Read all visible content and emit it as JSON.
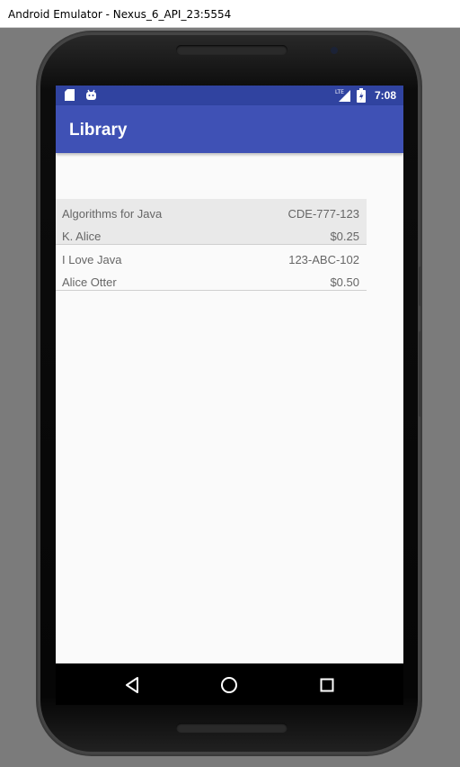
{
  "window": {
    "title": "Android Emulator - Nexus_6_API_23:5554"
  },
  "statusbar": {
    "time": "7:08",
    "network_label": "LTE"
  },
  "appbar": {
    "title": "Library"
  },
  "books": [
    {
      "title": "Algorithms for Java",
      "code": "CDE-777-123",
      "author": "K. Alice",
      "price": "$0.25",
      "selected": true
    },
    {
      "title": "I Love Java",
      "code": "123-ABC-102",
      "author": "Alice Otter",
      "price": "$0.50",
      "selected": false
    }
  ],
  "colors": {
    "statusbar": "#3043a0",
    "appbar": "#3f51b5",
    "selected_row": "#e9e9e9"
  }
}
